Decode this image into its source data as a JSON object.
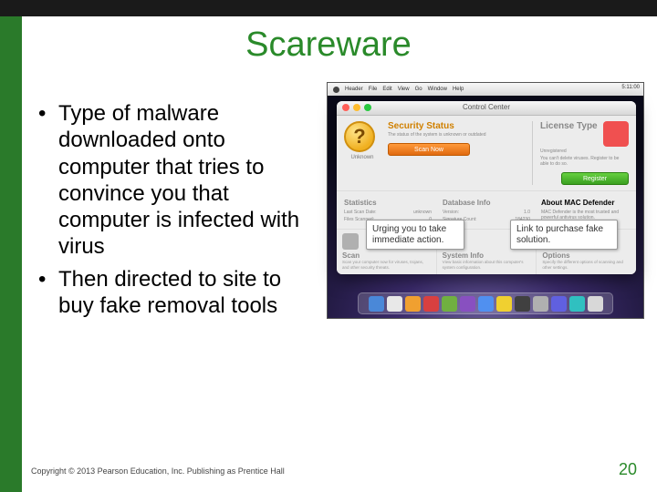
{
  "slide": {
    "title": "Scareware",
    "bullets": [
      "Type of malware downloaded onto computer that tries to convince you that computer is infected with virus",
      "Then directed to site to buy fake removal tools"
    ],
    "copyright": "Copyright © 2013 Pearson Education, Inc. Publishing as Prentice Hall",
    "page_number": "20"
  },
  "figure": {
    "menubar": {
      "items": [
        "Header",
        "File",
        "Edit",
        "View",
        "Go",
        "Window",
        "Help"
      ],
      "right": "5:11:00"
    },
    "dialog": {
      "title": "Control Center",
      "security": {
        "heading": "Security Status",
        "subtext": "The status of the system is unknown or outdated",
        "status_label": "Unknown",
        "button": "Scan Now"
      },
      "license": {
        "heading": "License Type",
        "status": "Unregistered",
        "subtext": "You can't delete viruses. Register to be able to do so.",
        "button": "Register"
      },
      "stats": {
        "heading": "Statistics",
        "rows": [
          {
            "k": "Last Scan Date:",
            "v": "unknown"
          },
          {
            "k": "Files Scanned:",
            "v": "0"
          }
        ]
      },
      "db": {
        "heading": "Database Info",
        "rows": [
          {
            "k": "Version:",
            "v": "1.0"
          },
          {
            "k": "Signature Count:",
            "v": "184230"
          }
        ]
      },
      "about": {
        "heading": "About MAC Defender",
        "text": "MAC Defender is the most trusted and powerful antivirus solution."
      },
      "footer": {
        "scan": {
          "heading": "Scan",
          "text": "Scan your computer now for viruses, trojans, and other security threats."
        },
        "sys": {
          "heading": "System Info",
          "text": "View basic information about this computer's system configuration."
        },
        "opt": {
          "heading": "Options",
          "text": "Specify the different options of scanning and other settings."
        }
      }
    },
    "callouts": {
      "c1": "Urging you to take immediate action.",
      "c2": "Link to purchase fake solution."
    }
  }
}
